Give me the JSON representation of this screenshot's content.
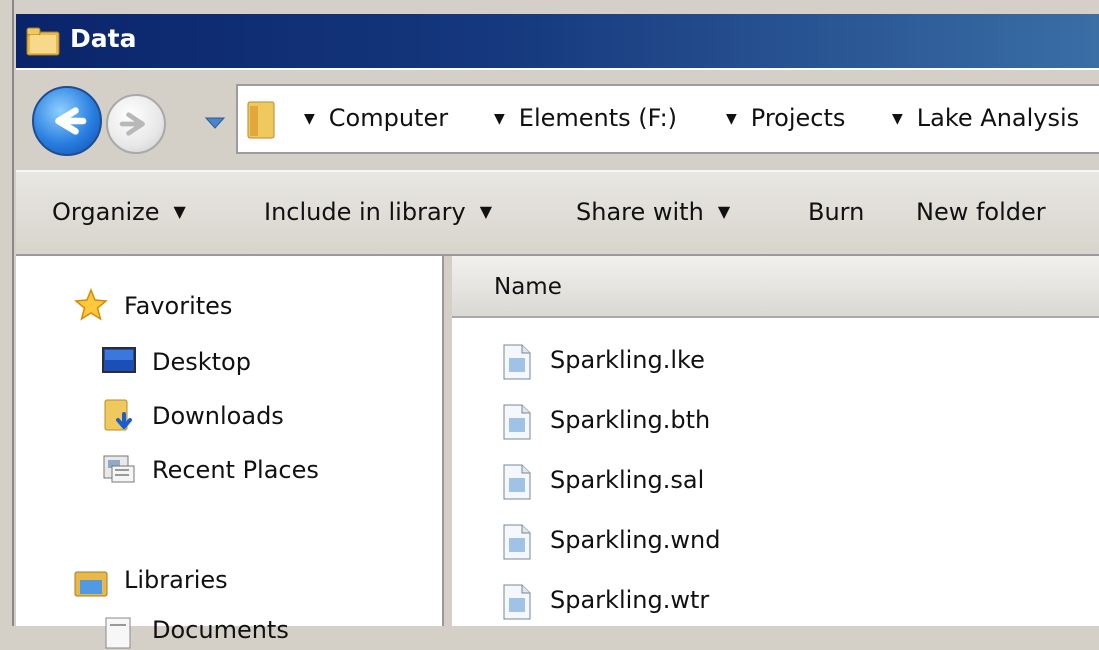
{
  "window": {
    "title": "Data"
  },
  "address": {
    "crumbs": [
      "Computer",
      "Elements (F:)",
      "Projects",
      "Lake Analysis"
    ]
  },
  "toolbar": {
    "organize": "Organize",
    "include_in_library": "Include in library",
    "share_with": "Share with",
    "burn": "Burn",
    "new_folder": "New folder"
  },
  "navpane": {
    "favorites": "Favorites",
    "desktop": "Desktop",
    "downloads": "Downloads",
    "recent_places": "Recent Places",
    "libraries": "Libraries",
    "documents": "Documents"
  },
  "files": {
    "column_name": "Name",
    "items": [
      {
        "name": "Sparkling.lke",
        "icon": "file-icon"
      },
      {
        "name": "Sparkling.bth",
        "icon": "file-icon"
      },
      {
        "name": "Sparkling.sal",
        "icon": "file-icon"
      },
      {
        "name": "Sparkling.wnd",
        "icon": "file-icon"
      },
      {
        "name": "Sparkling.wtr",
        "icon": "file-icon"
      }
    ]
  },
  "colors": {
    "titlebar_start": "#0a246a",
    "titlebar_end": "#3a6ea5",
    "frame": "#d4d0c8"
  }
}
